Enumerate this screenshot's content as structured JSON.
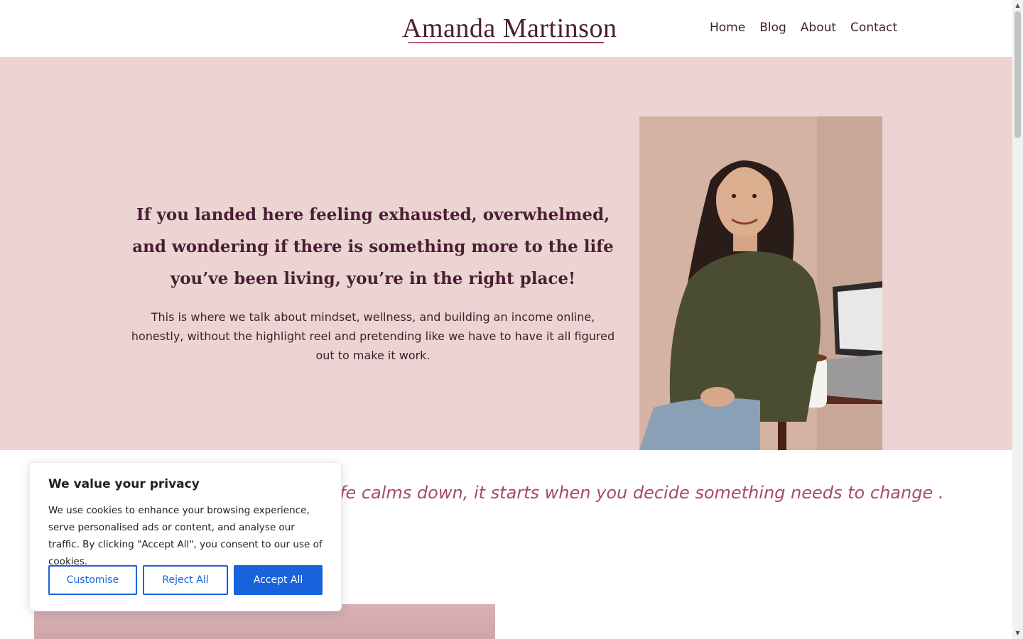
{
  "header": {
    "logo_text": "Amanda Martinson",
    "nav": [
      {
        "label": "Home"
      },
      {
        "label": "Blog"
      },
      {
        "label": "About"
      },
      {
        "label": "Contact"
      }
    ]
  },
  "hero": {
    "title": "If you landed here feeling exhausted, overwhelmed, and wondering if there is something more to the life you’ve been living, you’re in the right place!",
    "subtitle": "This is where we talk about mindset, wellness, and building an income online, honestly, without the highlight reel and pretending like we have to have it all figured out to make it work."
  },
  "quote": {
    "text": "fe calms down, it starts when you decide something needs to change ."
  },
  "cookie_banner": {
    "title": "We value your privacy",
    "text": "We use cookies to enhance your browsing experience, serve personalised ads or content, and analyse our traffic. By clicking \"Accept All\", you consent to our use of cookies.",
    "customise_label": "Customise",
    "reject_label": "Reject All",
    "accept_label": "Accept All"
  },
  "colors": {
    "hero_bg": "#ecd4d3",
    "brand_dark": "#4a1e33",
    "quote_pink": "#a8496c",
    "cookie_blue": "#1863dc"
  },
  "icons": {
    "scroll_up": "triangle-up-icon",
    "scroll_down": "triangle-down-icon"
  }
}
